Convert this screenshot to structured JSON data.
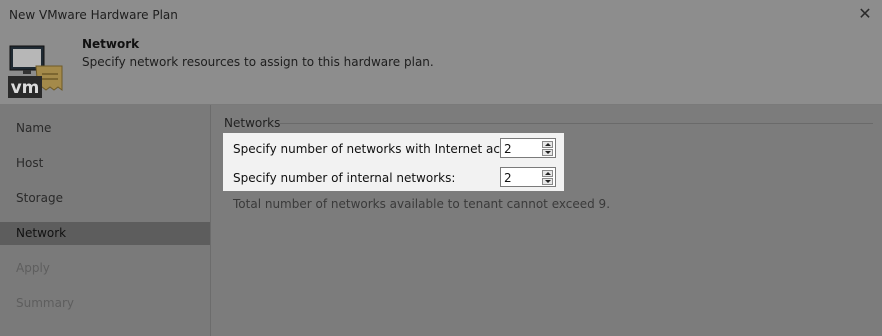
{
  "window": {
    "title": "New VMware Hardware Plan",
    "close_glyph": "✕"
  },
  "header": {
    "logo_text": "vm",
    "title": "Network",
    "subtitle": "Specify network resources to assign to this hardware plan."
  },
  "sidebar": {
    "items": [
      {
        "label": "Name",
        "state": "normal"
      },
      {
        "label": "Host",
        "state": "normal"
      },
      {
        "label": "Storage",
        "state": "normal"
      },
      {
        "label": "Network",
        "state": "active"
      },
      {
        "label": "Apply",
        "state": "disabled"
      },
      {
        "label": "Summary",
        "state": "disabled"
      }
    ]
  },
  "networks": {
    "group_label": "Networks",
    "internet_label": "Specify number of networks with Internet access:",
    "internet_value": "2",
    "internal_label": "Specify number of internal networks:",
    "internal_value": "2",
    "note": "Total number of networks available to tenant cannot exceed 9."
  },
  "colors": {
    "highlight": "#f2f2f2",
    "active_nav": "#5d5d5d",
    "overlay_gray": "#7c7c7c"
  }
}
